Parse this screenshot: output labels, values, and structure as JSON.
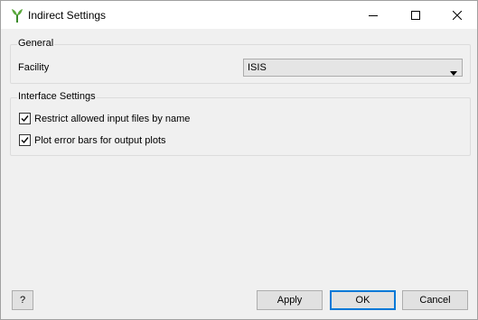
{
  "window": {
    "title": "Indirect Settings"
  },
  "groups": {
    "general": {
      "title": "General",
      "facility_label": "Facility",
      "facility_value": "ISIS"
    },
    "interface": {
      "title": "Interface Settings",
      "options": [
        {
          "label": "Restrict allowed input files by name",
          "checked": true
        },
        {
          "label": "Plot error bars for output plots",
          "checked": true
        }
      ]
    }
  },
  "buttons": {
    "help": "?",
    "apply": "Apply",
    "ok": "OK",
    "cancel": "Cancel"
  },
  "icons": {
    "app": "mantid-plant-icon",
    "dropdown": "chevron-down-icon"
  },
  "colors": {
    "default_button_border": "#0078d7"
  }
}
